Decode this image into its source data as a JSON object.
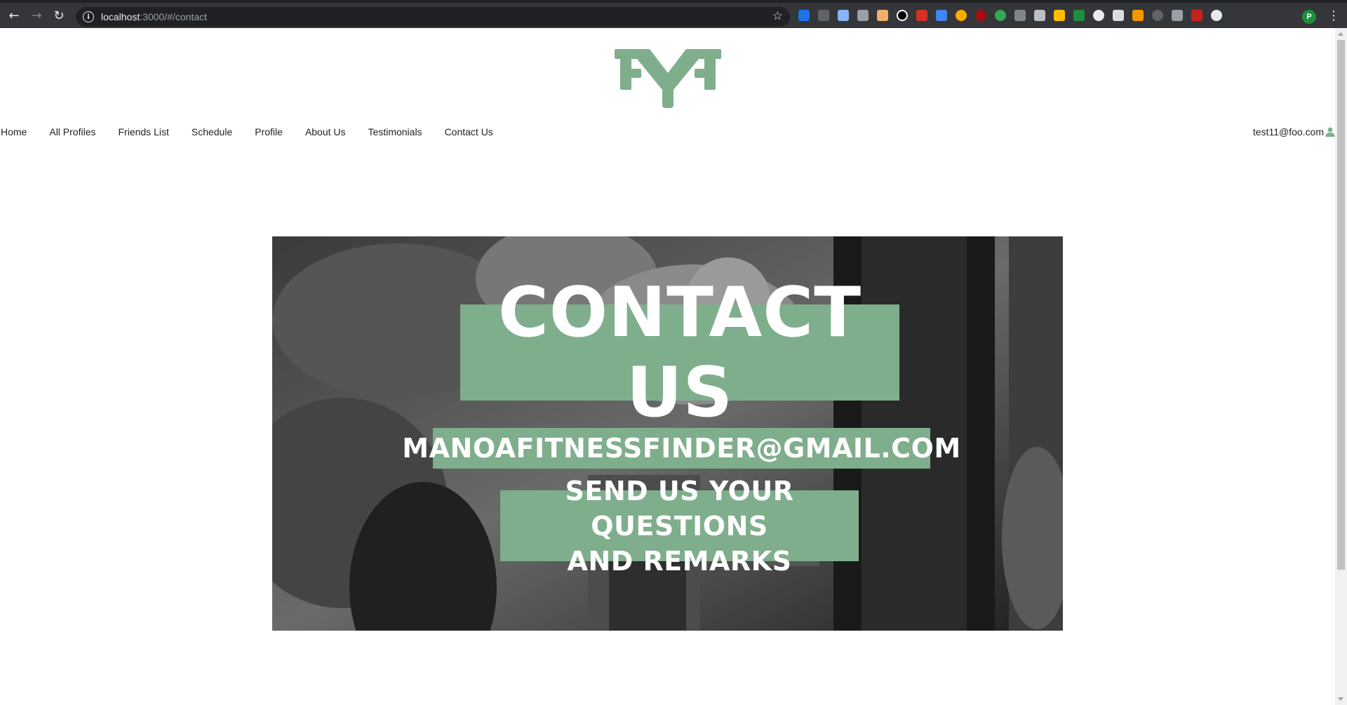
{
  "browser": {
    "url_host": "localhost",
    "url_path": ":3000/#/contact",
    "profile_initial": "P"
  },
  "nav": {
    "items": [
      {
        "label": "Home"
      },
      {
        "label": "All Profiles"
      },
      {
        "label": "Friends List"
      },
      {
        "label": "Schedule"
      },
      {
        "label": "Profile"
      },
      {
        "label": "About Us"
      },
      {
        "label": "Testimonials"
      },
      {
        "label": "Contact Us"
      }
    ],
    "user_email": "test11@foo.com"
  },
  "hero": {
    "title": "CONTACT US",
    "email": "MANOAFITNESSFINDER@GMAIL.COM",
    "note": "SEND US YOUR QUESTIONS\nAND REMARKS"
  },
  "colors": {
    "brand_green": "#7fae8c",
    "chrome_bg": "#35363a"
  },
  "icons": {
    "back": "arrow-left-icon",
    "forward": "arrow-right-icon",
    "reload": "reload-icon",
    "info": "info-icon",
    "bookmark": "star-icon",
    "user": "user-icon",
    "menu": "kebab-menu-icon"
  }
}
